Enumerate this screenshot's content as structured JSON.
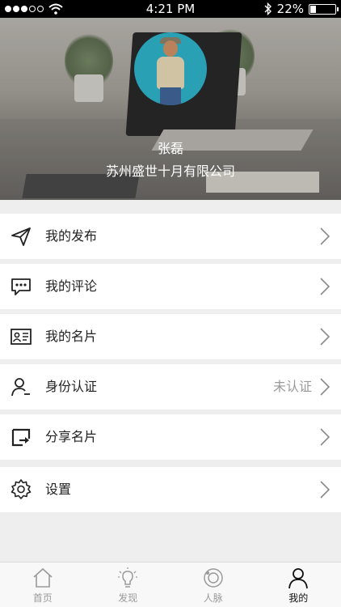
{
  "status_bar": {
    "time": "4:21 PM",
    "battery_percent": "22%",
    "battery_level": 0.22,
    "signal_dots_filled": 3,
    "signal_dots_total": 5
  },
  "profile": {
    "name": "张磊",
    "company": "苏州盛世十月有限公司",
    "avatar_icon": "person-photo"
  },
  "menu": {
    "items": [
      {
        "label": "我的发布",
        "icon": "paper-plane-icon",
        "status": ""
      },
      {
        "label": "我的评论",
        "icon": "comment-icon",
        "status": ""
      },
      {
        "label": "我的名片",
        "icon": "business-card-icon",
        "status": ""
      },
      {
        "label": "身份认证",
        "icon": "user-icon",
        "status": "未认证"
      },
      {
        "label": "分享名片",
        "icon": "share-icon",
        "status": ""
      },
      {
        "label": "设置",
        "icon": "gear-icon",
        "status": ""
      }
    ]
  },
  "tabbar": {
    "tabs": [
      {
        "label": "首页",
        "icon": "home-icon",
        "active": false
      },
      {
        "label": "发现",
        "icon": "lightbulb-icon",
        "active": false
      },
      {
        "label": "人脉",
        "icon": "network-icon",
        "active": false
      },
      {
        "label": "我的",
        "icon": "user-icon",
        "active": true
      }
    ]
  },
  "colors": {
    "accent": "#111111",
    "inactive": "#9a9a9a",
    "background": "#eeeeee",
    "avatar_bg": "#2aa0b5"
  }
}
